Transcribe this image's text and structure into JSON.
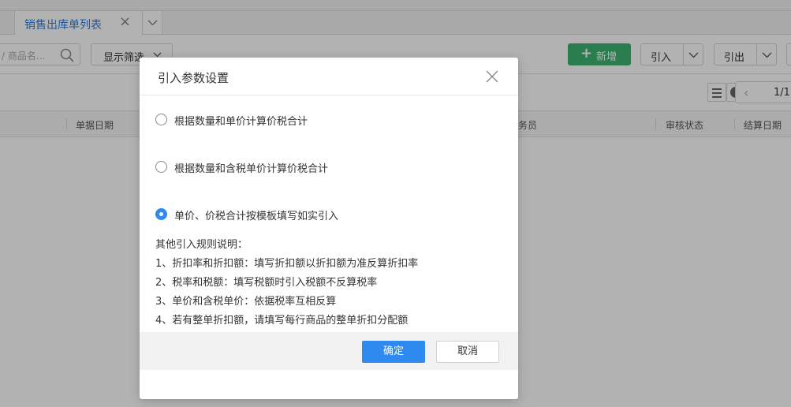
{
  "tabs": [
    {
      "label": "销售出库单列表",
      "active": true
    }
  ],
  "toolbar": {
    "search_placeholder": "/ 商品名...",
    "filter_label": "显示筛选",
    "new_label": "新增",
    "import_label": "引入",
    "export_label": "引出"
  },
  "pager": {
    "page": "1/1"
  },
  "table": {
    "columns": [
      "单据日期",
      "务员",
      "审核状态",
      "结算日期"
    ]
  },
  "dialog": {
    "title": "引入参数设置",
    "options": [
      {
        "label": "根据数量和单价计算价税合计",
        "selected": false
      },
      {
        "label": "根据数量和含税单价计算价税合计",
        "selected": false
      },
      {
        "label": "单价、价税合计按模板填写如实引入",
        "selected": true
      }
    ],
    "notes_title": "其他引入规则说明：",
    "notes": [
      "1、折扣率和折扣额：填写折扣额以折扣额为准反算折扣率",
      "2、税率和税额：填写税额时引入税额不反算税率",
      "3、单价和含税单价：依据税率互相反算",
      "4、若有整单折扣额，请填写每行商品的整单折扣分配额"
    ],
    "confirm_label": "确定",
    "cancel_label": "取消"
  },
  "colors": {
    "primary": "#2f8af0",
    "success": "#3cb371",
    "tab_active_text": "#2a7de1"
  }
}
